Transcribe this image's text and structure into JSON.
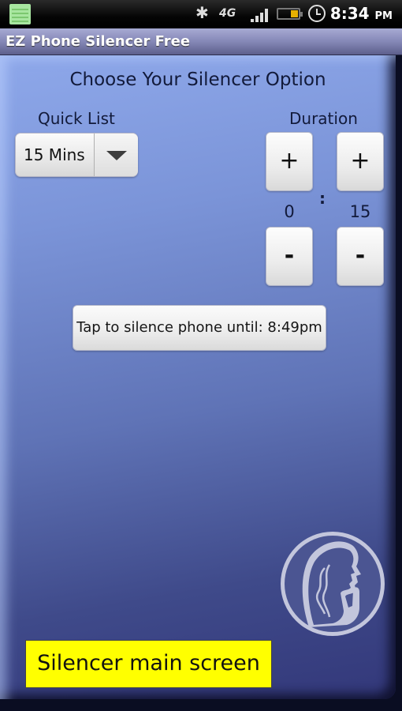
{
  "status_bar": {
    "icons": [
      "notes-icon",
      "bluetooth-icon",
      "4g-icon",
      "signal-icon",
      "battery-icon",
      "alarm-icon"
    ],
    "network_label": "4G",
    "time": "8:34",
    "ampm": "PM",
    "battery_level": 0.3,
    "signal_bars": 4
  },
  "app": {
    "title": "EZ Phone Silencer Free"
  },
  "main": {
    "heading": "Choose Your Silencer Option",
    "quick_list": {
      "label": "Quick List",
      "selected": "15 Mins"
    },
    "duration": {
      "label": "Duration",
      "hours": "0",
      "minutes": "15",
      "separator": ":",
      "plus_label": "+",
      "minus_label": "-"
    },
    "silence_button": "Tap to silence phone until: 8:49pm",
    "logo": "silhouette-shush-icon"
  },
  "caption": "Silencer main screen",
  "colors": {
    "caption_bg": "#ffff00",
    "panel_top": "#8ea8ea",
    "panel_bottom": "#33387a",
    "title_bar": "#8588b7"
  }
}
